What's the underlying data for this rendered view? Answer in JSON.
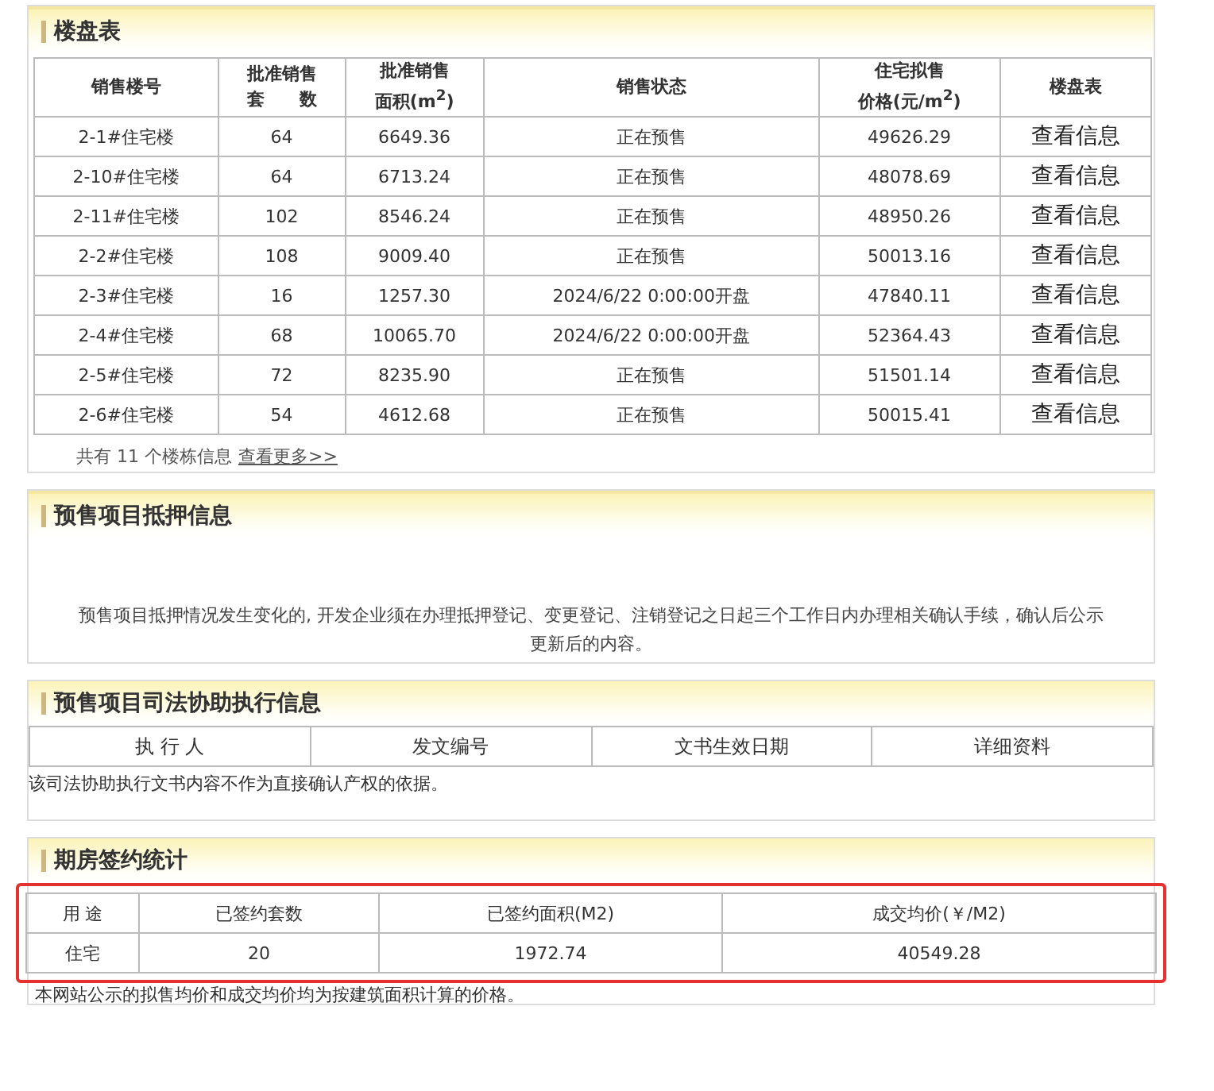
{
  "building_table": {
    "title": "楼盘表",
    "columns": [
      "销售楼号",
      "批准销售套　　数",
      "批准销售面积(m$^{2}$)",
      "销售状态",
      "住宅拟售价格(元/m$^{2}$)",
      "楼盘表"
    ],
    "rows": [
      {
        "cells": [
          "2-1#住宅楼",
          "64",
          "6649.36",
          "正在预售",
          "49626.29"
        ],
        "link": "查看信息"
      },
      {
        "cells": [
          "2-10#住宅楼",
          "64",
          "6713.24",
          "正在预售",
          "48078.69"
        ],
        "link": "查看信息"
      },
      {
        "cells": [
          "2-11#住宅楼",
          "102",
          "8546.24",
          "正在预售",
          "48950.26"
        ],
        "link": "查看信息"
      },
      {
        "cells": [
          "2-2#住宅楼",
          "108",
          "9009.40",
          "正在预售",
          "50013.16"
        ],
        "link": "查看信息"
      },
      {
        "cells": [
          "2-3#住宅楼",
          "16",
          "1257.30",
          "2024/6/22 0:00:00开盘",
          "47840.11"
        ],
        "link": "查看信息"
      },
      {
        "cells": [
          "2-4#住宅楼",
          "68",
          "10065.70",
          "2024/6/22 0:00:00开盘",
          "52364.43"
        ],
        "link": "查看信息"
      },
      {
        "cells": [
          "2-5#住宅楼",
          "72",
          "8235.90",
          "正在预售",
          "51501.14"
        ],
        "link": "查看信息"
      },
      {
        "cells": [
          "2-6#住宅楼",
          "54",
          "4612.68",
          "正在预售",
          "50015.41"
        ],
        "link": "查看信息"
      }
    ],
    "summary": "共有 11 个楼栋信息",
    "more_link": "查看更多>>"
  },
  "mortgage": {
    "title": "预售项目抵押信息",
    "note": "预售项目抵押情况发生变化的, 开发企业须在办理抵押登记、变更登记、注销登记之日起三个工作日内办理相关确认手续，确认后公示更新后的内容。"
  },
  "judicial": {
    "title": "预售项目司法协助执行信息",
    "columns": [
      "执 行 人",
      "发文编号",
      "文书生效日期",
      "详细资料"
    ],
    "note": "该司法协助执行文书内容不作为直接确认产权的依据。"
  },
  "contracts": {
    "title": "期房签约统计",
    "highlighted": true,
    "columns": [
      "用 途",
      "已签约套数",
      "已签约面积(M2)",
      "成交均价(￥/M2)"
    ],
    "rows": [
      [
        "住宅",
        "20",
        "1972.74",
        "40549.28"
      ]
    ],
    "note": "本网站公示的拟售均价和成交均价均为按建筑面积计算的价格。"
  }
}
